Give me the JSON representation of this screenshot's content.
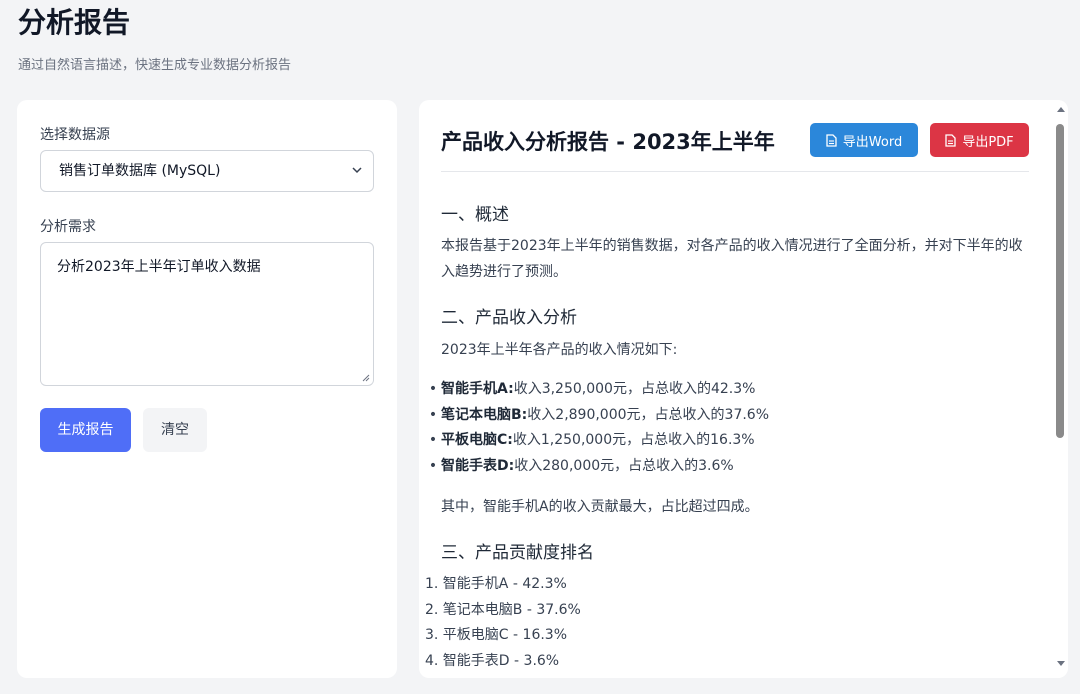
{
  "header": {
    "title": "分析报告",
    "subtitle": "通过自然语言描述，快速生成专业数据分析报告"
  },
  "form": {
    "datasource_label": "选择数据源",
    "datasource_value": "销售订单数据库 (MySQL)",
    "requirement_label": "分析需求",
    "requirement_value": "分析2023年上半年订单收入数据",
    "generate_label": "生成报告",
    "clear_label": "清空"
  },
  "report": {
    "title": "产品收入分析报告 - 2023年上半年",
    "export_word_label": "导出Word",
    "export_pdf_label": "导出PDF",
    "section1_heading": "一、概述",
    "section1_text": "本报告基于2023年上半年的销售数据，对各产品的收入情况进行了全面分析，并对下半年的收入趋势进行了预测。",
    "section2_heading": "二、产品收入分析",
    "section2_intro": "2023年上半年各产品的收入情况如下:",
    "products": [
      {
        "name": "智能手机A:",
        "detail": "收入3,250,000元，占总收入的42.3%"
      },
      {
        "name": "笔记本电脑B:",
        "detail": "收入2,890,000元，占总收入的37.6%"
      },
      {
        "name": "平板电脑C:",
        "detail": "收入1,250,000元，占总收入的16.3%"
      },
      {
        "name": "智能手表D:",
        "detail": "收入280,000元，占总收入的3.6%"
      }
    ],
    "section2_summary": "其中，智能手机A的收入贡献最大，占比超过四成。",
    "section3_heading": "三、产品贡献度排名",
    "ranking": [
      "1. 智能手机A - 42.3%",
      "2. 笔记本电脑B - 37.6%",
      "3. 平板电脑C - 16.3%",
      "4. 智能手表D - 3.6%"
    ]
  },
  "colors": {
    "primary": "#4f6ef7",
    "word": "#2b87da",
    "pdf": "#dc3545"
  },
  "icons": {
    "select_arrow": "chevron-down-icon",
    "export": "document-icon"
  }
}
